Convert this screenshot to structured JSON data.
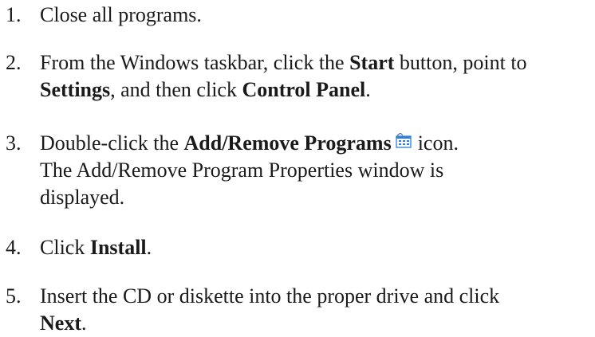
{
  "steps": [
    {
      "number": "1.",
      "lines": [
        {
          "parts": [
            "Close all programs."
          ]
        }
      ]
    },
    {
      "number": "2.",
      "lines": [
        {
          "parts": [
            "From the Windows taskbar, click the ",
            "Start",
            " button, point to"
          ]
        },
        {
          "parts": [
            "Settings",
            ", and then click ",
            "Control Panel",
            "."
          ]
        }
      ]
    },
    {
      "number": "3.",
      "lines": [
        {
          "parts": [
            "Double-click the ",
            "Add/Remove Programs",
            "icon."
          ]
        },
        {
          "parts": [
            "The Add/Remove Program Properties window is"
          ]
        },
        {
          "parts": [
            "displayed."
          ]
        }
      ]
    },
    {
      "number": "4.",
      "lines": [
        {
          "parts": [
            "Click ",
            "Install",
            "."
          ]
        }
      ]
    },
    {
      "number": "5.",
      "lines": [
        {
          "parts": [
            "Insert the CD or diskette into the proper drive and click"
          ]
        },
        {
          "parts": [
            "Next",
            "."
          ]
        }
      ]
    }
  ],
  "icons": {
    "add_remove": "add-remove-programs-icon"
  },
  "colors": {
    "text": "#1a1a1a",
    "icon_blue": "#2f7fd6"
  }
}
